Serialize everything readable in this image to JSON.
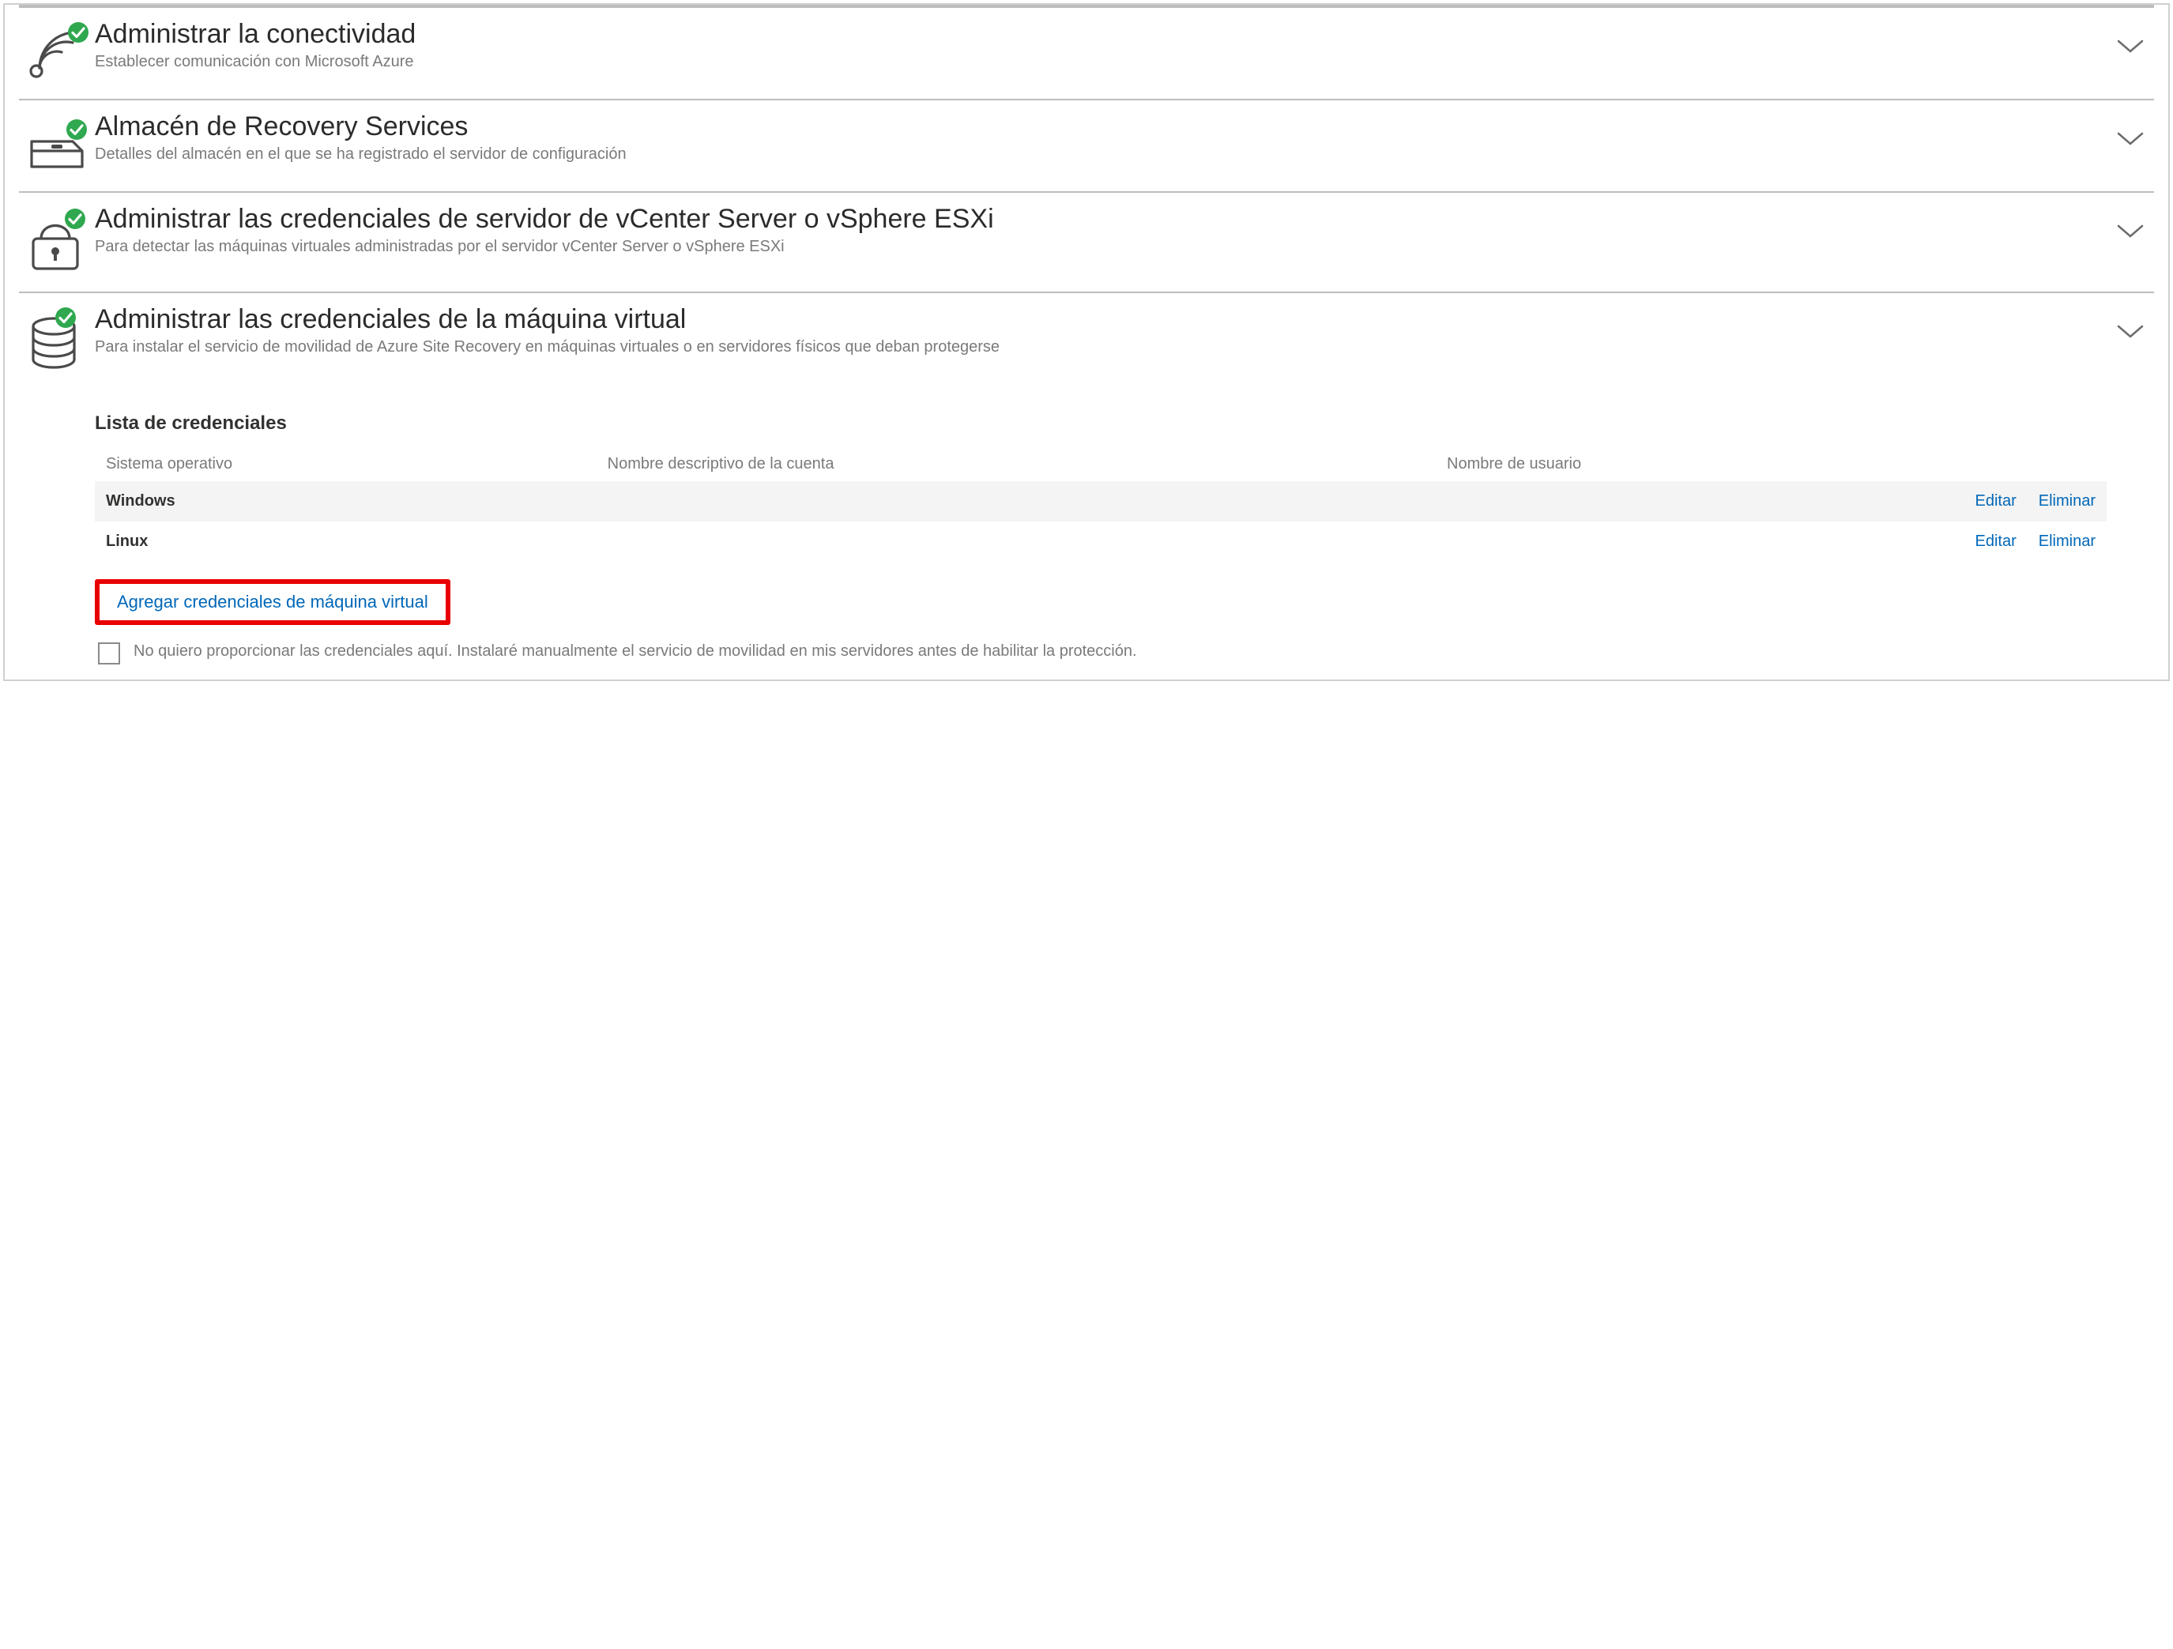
{
  "sections": {
    "connectivity": {
      "title": "Administrar la conectividad",
      "subtitle": "Establecer comunicación con Microsoft Azure"
    },
    "vault": {
      "title": "Almacén de Recovery Services",
      "subtitle": "Detalles del almacén en el que se ha registrado el servidor de configuración"
    },
    "vcenter": {
      "title": "Administrar las credenciales de servidor de vCenter Server o vSphere ESXi",
      "subtitle": "Para detectar las máquinas virtuales administradas por el servidor vCenter Server o vSphere ESXi"
    },
    "vmcred": {
      "title": "Administrar las credenciales de la máquina virtual",
      "subtitle": "Para instalar el servicio de movilidad de Azure Site Recovery en máquinas virtuales o en servidores físicos que deban protegerse"
    }
  },
  "credentials": {
    "list_title": "Lista de credenciales",
    "columns": {
      "os": "Sistema operativo",
      "friendly": "Nombre descriptivo de la cuenta",
      "user": "Nombre de usuario"
    },
    "rows": [
      {
        "os": "Windows",
        "friendly": "",
        "user": ""
      },
      {
        "os": "Linux",
        "friendly": "",
        "user": ""
      }
    ],
    "actions": {
      "edit": "Editar",
      "delete": "Eliminar"
    },
    "add_link": "Agregar credenciales de máquina virtual",
    "opt_out": "No quiero proporcionar las credenciales aquí. Instalaré manualmente el servicio de movilidad en mis servidores antes de habilitar la protección."
  }
}
